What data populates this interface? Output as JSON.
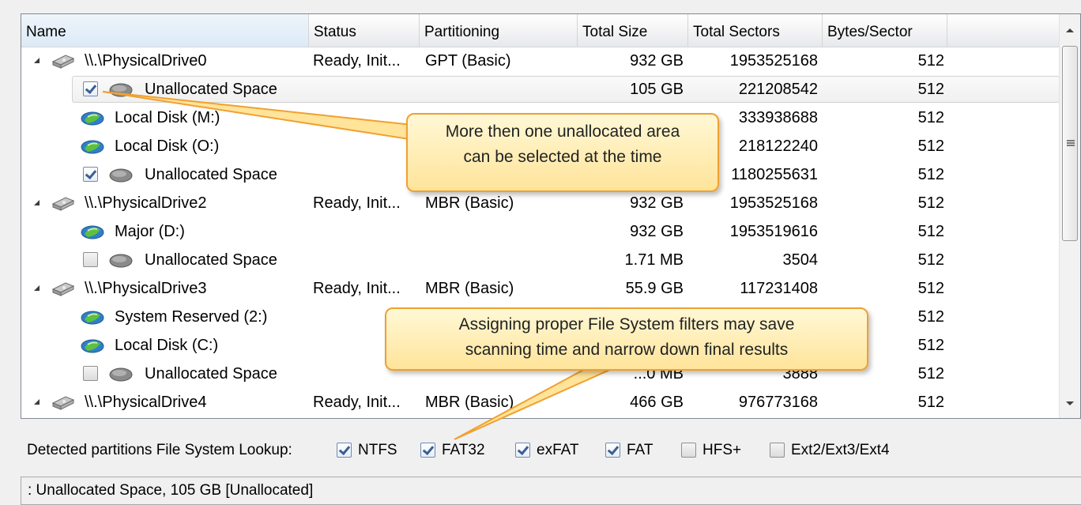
{
  "columns": [
    "Name",
    "Status",
    "Partitioning",
    "Total Size",
    "Total Sectors",
    "Bytes/Sector"
  ],
  "rows": [
    {
      "type": "drive",
      "name": "\\\\.\\PhysicalDrive0",
      "status": "Ready, Init...",
      "partitioning": "GPT (Basic)",
      "size": "932 GB",
      "sectors": "1953525168",
      "bytes": "512"
    },
    {
      "type": "unalloc",
      "checked": true,
      "selected": true,
      "name": "Unallocated Space",
      "size": "105 GB",
      "sectors": "221208542",
      "bytes": "512"
    },
    {
      "type": "volume",
      "name": "Local Disk (M:)",
      "size": "",
      "sectors": "333938688",
      "bytes": "512"
    },
    {
      "type": "volume",
      "name": "Local Disk (O:)",
      "size": "",
      "sectors": "218122240",
      "bytes": "512"
    },
    {
      "type": "unalloc",
      "checked": true,
      "name": "Unallocated Space",
      "size": "",
      "sectors": "1180255631",
      "bytes": "512"
    },
    {
      "type": "drive",
      "name": "\\\\.\\PhysicalDrive2",
      "status": "Ready, Init...",
      "partitioning": "MBR (Basic)",
      "size": "932 GB",
      "sectors": "1953525168",
      "bytes": "512"
    },
    {
      "type": "volume",
      "name": "Major (D:)",
      "size": "932 GB",
      "sectors": "1953519616",
      "bytes": "512"
    },
    {
      "type": "unalloc",
      "checked": false,
      "name": "Unallocated Space",
      "size": "1.71 MB",
      "sectors": "3504",
      "bytes": "512"
    },
    {
      "type": "drive",
      "name": "\\\\.\\PhysicalDrive3",
      "status": "Ready, Init...",
      "partitioning": "MBR (Basic)",
      "size": "55.9 GB",
      "sectors": "117231408",
      "bytes": "512"
    },
    {
      "type": "volume",
      "name": "System Reserved (2:)",
      "size": "",
      "sectors": "",
      "bytes": "512"
    },
    {
      "type": "volume",
      "name": "Local Disk (C:)",
      "size": "",
      "sectors": "",
      "bytes": "512"
    },
    {
      "type": "unalloc",
      "checked": false,
      "name": "Unallocated Space",
      "size": "...0 MB",
      "sectors": "3888",
      "bytes": "512"
    },
    {
      "type": "drive",
      "name": "\\\\.\\PhysicalDrive4",
      "status": "Ready, Init...",
      "partitioning": "MBR (Basic)",
      "size": "466 GB",
      "sectors": "976773168",
      "bytes": "512"
    }
  ],
  "filters": {
    "label": "Detected partitions File System Lookup:",
    "items": [
      {
        "label": "NTFS",
        "checked": true
      },
      {
        "label": "FAT32",
        "checked": true
      },
      {
        "label": "exFAT",
        "checked": true
      },
      {
        "label": "FAT",
        "checked": true
      },
      {
        "label": "HFS+",
        "checked": false
      },
      {
        "label": "Ext2/Ext3/Ext4",
        "checked": false
      }
    ]
  },
  "status_bar": ": Unallocated Space, 105 GB [Unallocated]",
  "callouts": {
    "top": [
      "More then one unallocated area",
      "can be selected at the time"
    ],
    "bottom": [
      "Assigning proper File System filters may save",
      "scanning time and narrow down final results"
    ]
  },
  "colors": {
    "callout_fill": "#ffe49a",
    "callout_border": "#f0a030",
    "header_bg": "#f3f3f4"
  }
}
